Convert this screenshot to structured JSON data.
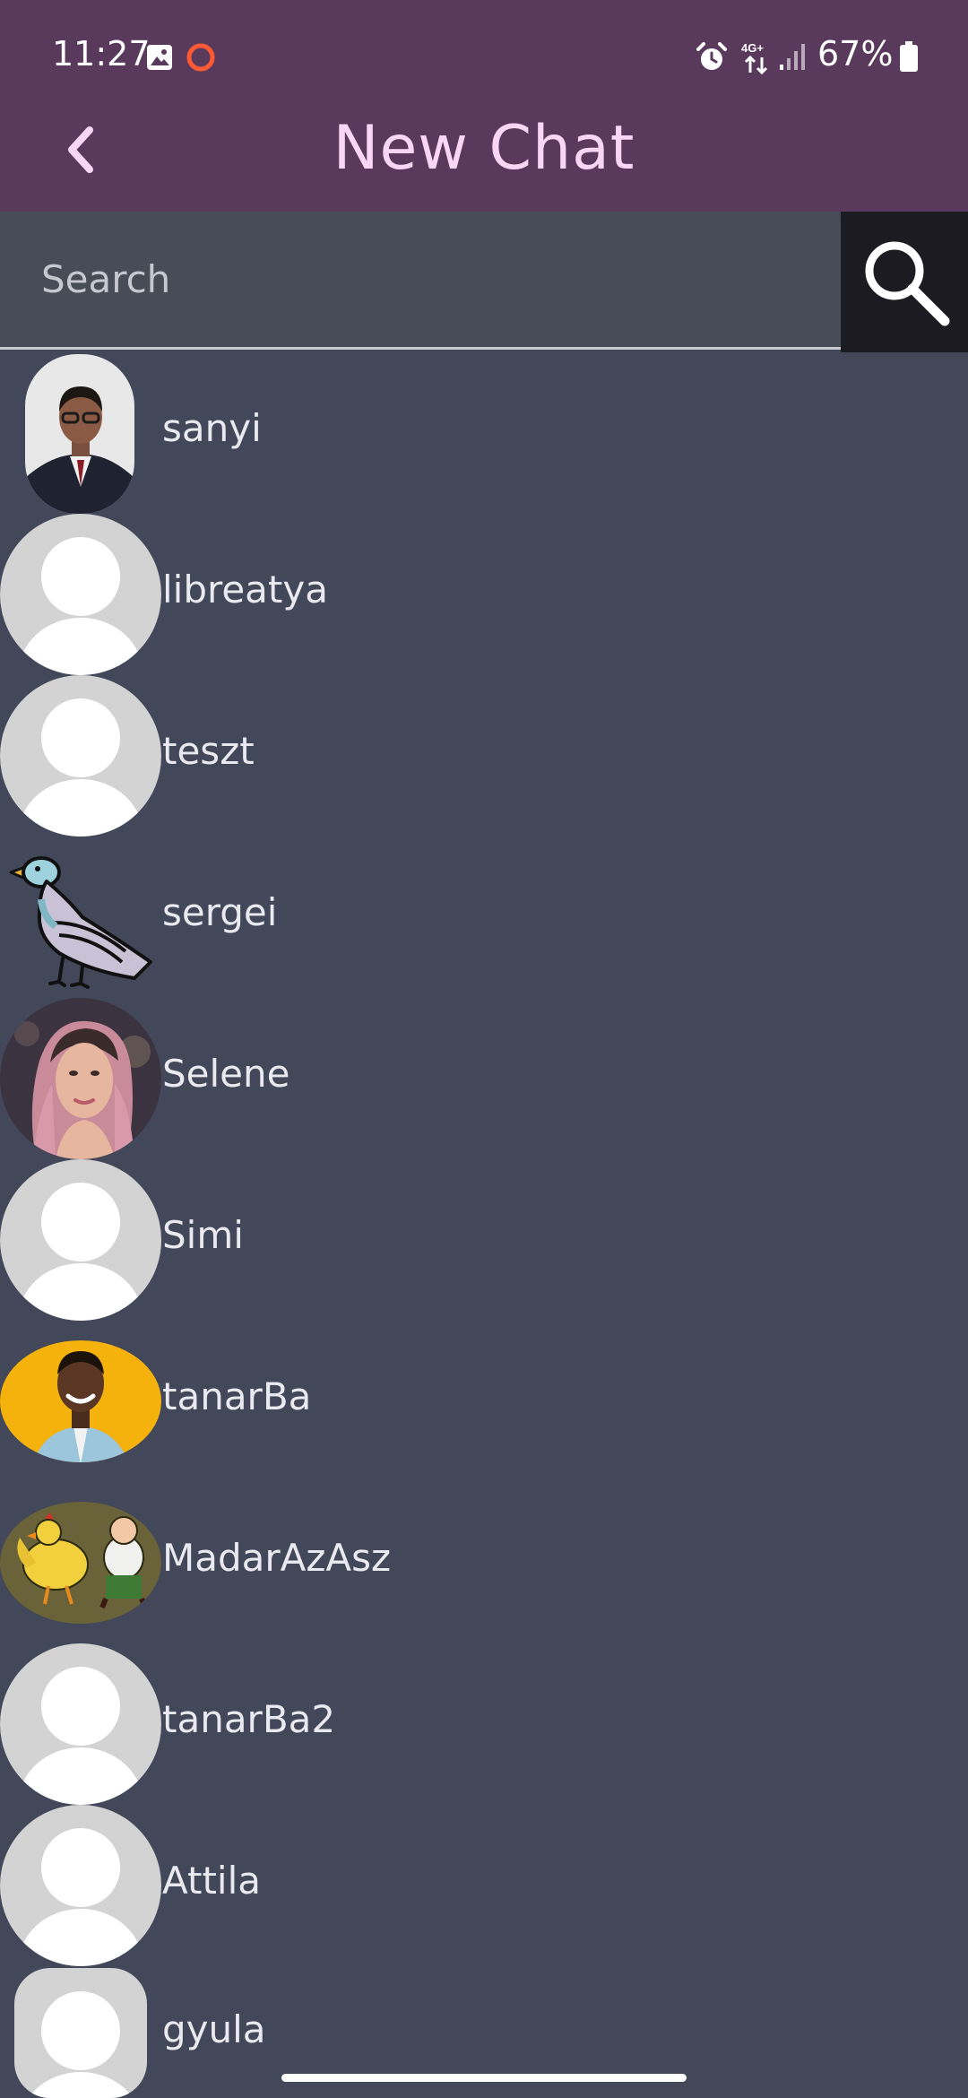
{
  "status_bar": {
    "time": "11:27",
    "network_label": "4G+",
    "battery": "67%",
    "icons": [
      "gallery-icon",
      "record-icon",
      "alarm-icon",
      "network-4g-icon",
      "signal-icon",
      "battery-icon"
    ]
  },
  "header": {
    "title": "New Chat",
    "back_icon": "chevron-left-icon",
    "background": "#5a3a5c",
    "title_color": "#f9d5f6"
  },
  "search": {
    "placeholder": "Search",
    "value": "",
    "button_icon": "search-icon"
  },
  "contacts": [
    {
      "name": "sanyi",
      "avatar": "photo-man-suit"
    },
    {
      "name": "libreatya",
      "avatar": "default-person"
    },
    {
      "name": "teszt",
      "avatar": "default-person"
    },
    {
      "name": "sergei",
      "avatar": "pigeon-drawing"
    },
    {
      "name": "Selene",
      "avatar": "photo-woman-pink-hair"
    },
    {
      "name": "Simi",
      "avatar": "default-person"
    },
    {
      "name": "tanarBa",
      "avatar": "photo-man-yellow-bg"
    },
    {
      "name": "MadarAzAsz",
      "avatar": "cartoon-chicken"
    },
    {
      "name": "tanarBa2",
      "avatar": "default-person"
    },
    {
      "name": "Attila",
      "avatar": "default-person"
    },
    {
      "name": "gyula",
      "avatar": "default-person"
    }
  ],
  "colors": {
    "list_background": "#424759",
    "search_background": "#484c56",
    "search_button_background": "#1c1b21",
    "default_avatar_bg": "#d3d3d3"
  }
}
